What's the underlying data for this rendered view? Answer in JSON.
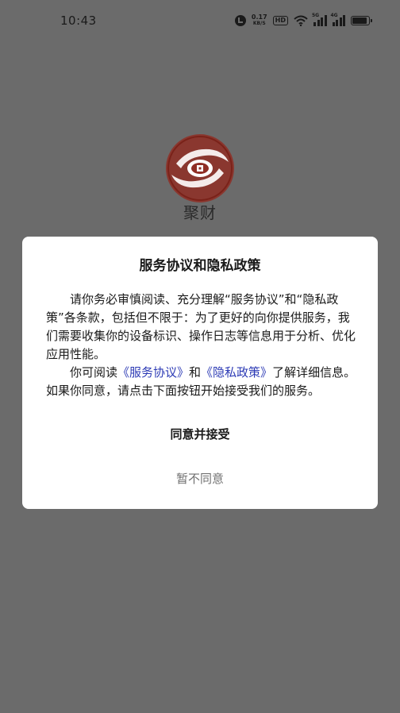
{
  "status_bar": {
    "time": "10:43",
    "net_speed": "0.17",
    "net_speed_unit": "KB/S",
    "hd_badge": "HD",
    "signal1_tag": "5G",
    "signal2_tag": "4G",
    "battery_level": 0.9
  },
  "app": {
    "name": "聚财",
    "logo_colors": {
      "outer": "#8f2e25",
      "inner": "#ffffff"
    }
  },
  "dialog": {
    "title": "服务协议和隐私政策",
    "para1": "请你务必审慎阅读、充分理解“服务协议”和“隐私政策”各条款，包括但不限于：为了更好的向你提供服务，我们需要收集你的设备标识、操作日志等信息用于分析、优化应用性能。",
    "para2_prefix": "你可阅读",
    "link_service": "《服务协议》",
    "para2_and": "和",
    "link_privacy": "《隐私政策》",
    "para2_suffix": "了解详细信息。如果你同意，请点击下面按钮开始接受我们的服务。",
    "accept_label": "同意并接受",
    "decline_label": "暂不同意",
    "link_color": "#2d3bb5"
  }
}
